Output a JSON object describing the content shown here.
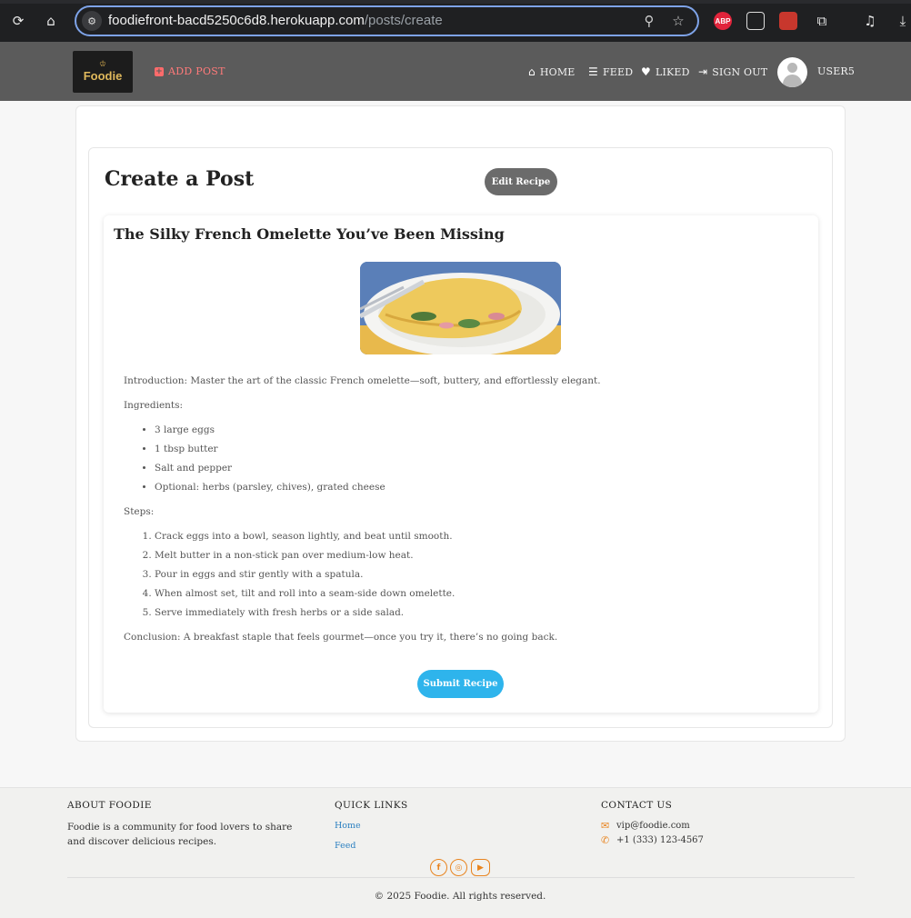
{
  "browser": {
    "url_domain": "foodiefront-bacd5250c6d8.herokuapp.com",
    "url_path": "/posts/create",
    "extensions": [
      "ABP"
    ]
  },
  "navbar": {
    "logo_text": "Foodie",
    "add_post": "ADD POST",
    "home": "HOME",
    "feed": "FEED",
    "liked": "LIKED",
    "sign_out": "SIGN OUT",
    "username": "USER5"
  },
  "page": {
    "title": "Create a Post",
    "edit_button": "Edit Recipe",
    "submit_button": "Submit Recipe"
  },
  "recipe": {
    "title": "The Silky French Omelette You’ve Been Missing",
    "introduction": "Introduction: Master the art of the classic French omelette—soft, buttery, and effortlessly elegant.",
    "ingredients_label": "Ingredients:",
    "ingredients": [
      "3 large eggs",
      "1 tbsp butter",
      "Salt and pepper",
      "Optional: herbs (parsley, chives), grated cheese"
    ],
    "steps_label": "Steps:",
    "steps": [
      "Crack eggs into a bowl, season lightly, and beat until smooth.",
      "Melt butter in a non-stick pan over medium-low heat.",
      "Pour in eggs and stir gently with a spatula.",
      "When almost set, tilt and roll into a seam-side down omelette.",
      "Serve immediately with fresh herbs or a side salad."
    ],
    "conclusion": "Conclusion: A breakfast staple that feels gourmet—once you try it, there’s no going back."
  },
  "footer": {
    "about_heading": "ABOUT FOODIE",
    "about_text": "Foodie is a community for food lovers to share and discover delicious recipes.",
    "links_heading": "QUICK LINKS",
    "links": [
      "Home",
      "Feed"
    ],
    "contact_heading": "CONTACT US",
    "email": "vip@foodie.com",
    "phone": "+1 (333) 123-4567",
    "copyright": "© 2025 Foodie. All rights reserved."
  },
  "colors": {
    "navbar_bg": "#5b5b5b",
    "add_post": "#ff7a7a",
    "submit_button": "#2eb4ec",
    "edit_button": "#6b6b6b",
    "footer_accent": "#e8841f"
  }
}
